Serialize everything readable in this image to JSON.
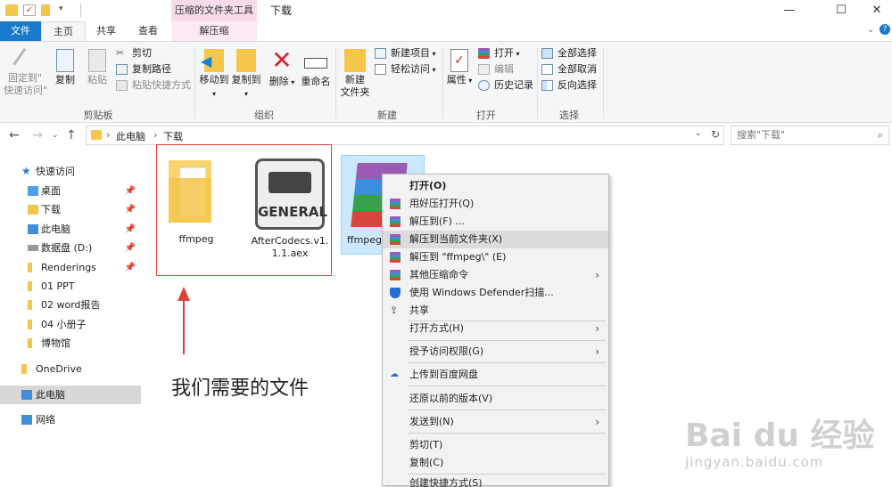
{
  "titlebar": {
    "contextual_tab_header": "压缩的文件夹工具",
    "title": "下载",
    "minimize": "—",
    "maximize": "☐",
    "close": "✕"
  },
  "tabs": {
    "file": "文件",
    "home": "主页",
    "share": "共享",
    "view": "查看",
    "extract": "解压缩"
  },
  "ribbon": {
    "clipboard": {
      "label": "剪贴板",
      "pin": "固定到\"\n快速访问\"",
      "copy": "复制",
      "paste": "粘贴",
      "cut": "剪切",
      "copy_path": "复制路径",
      "paste_shortcut": "粘贴快捷方式"
    },
    "organize": {
      "label": "组织",
      "move_to": "移动到",
      "copy_to": "复制到",
      "delete": "删除",
      "rename": "重命名"
    },
    "new": {
      "label": "新建",
      "new_folder": "新建\n文件夹",
      "new_item": "新建项目",
      "easy_access": "轻松访问"
    },
    "open": {
      "label": "打开",
      "properties": "属性",
      "open": "打开",
      "edit": "编辑",
      "history": "历史记录"
    },
    "select": {
      "label": "选择",
      "select_all": "全部选择",
      "select_none": "全部取消",
      "invert": "反向选择"
    }
  },
  "address": {
    "crumb_1": "此电脑",
    "crumb_2": "下载",
    "search_placeholder": "搜索\"下载\""
  },
  "navpane": {
    "quick_access": "快速访问",
    "desktop": "桌面",
    "downloads": "下载",
    "this_pc_pinned": "此电脑",
    "data_drive": "数据盘 (D:)",
    "renderings": "Renderings",
    "f1": "01 PPT",
    "f2": "02 word报告",
    "f3": "04 小册子",
    "f4": "博物馆",
    "onedrive": "OneDrive",
    "this_pc": "此电脑",
    "network": "网络"
  },
  "files": {
    "folder_name": "ffmpeg",
    "aex_name_line1": "AfterCodecs.v1.",
    "aex_name_line2": "1.1.aex",
    "aex_badge": "GENERAL",
    "rar_name": "ffmpeg"
  },
  "annotation": {
    "text": "我们需要的文件",
    "color": "#e0403a"
  },
  "context_menu": {
    "items": [
      {
        "label": "打开(O)"
      },
      {
        "label": "用好压打开(Q)"
      },
      {
        "label": "解压到(F) ..."
      },
      {
        "label": "解压到当前文件夹(X)"
      },
      {
        "label": "解压到 \"ffmpeg\\\" (E)"
      },
      {
        "label": "其他压缩命令"
      },
      {
        "label": "使用 Windows Defender扫描..."
      },
      {
        "label": "共享"
      },
      {
        "label": "打开方式(H)"
      },
      {
        "label": "授予访问权限(G)"
      },
      {
        "label": "上传到百度网盘"
      },
      {
        "label": "还原以前的版本(V)"
      },
      {
        "label": "发送到(N)"
      },
      {
        "label": "剪切(T)"
      },
      {
        "label": "复制(C)"
      },
      {
        "label": "创建快捷方式(S)"
      }
    ]
  },
  "watermark": {
    "brand": "Bai du 经验",
    "url": "jingyan.baidu.com"
  }
}
